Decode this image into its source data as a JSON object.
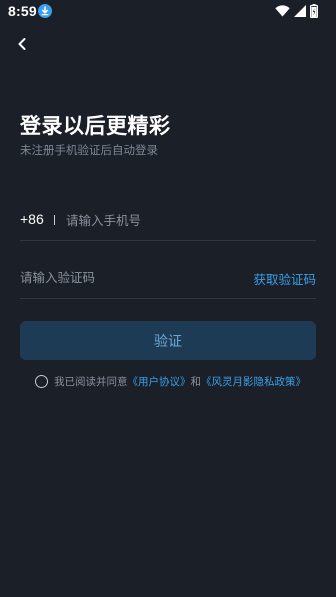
{
  "status_bar": {
    "time": "8:59",
    "download_icon": "download-badge-icon",
    "wifi_icon": "wifi-icon",
    "signal_icon": "cell-signal-icon",
    "battery_icon": "battery-charging-icon"
  },
  "header": {
    "back_icon": "chevron-left-icon"
  },
  "main": {
    "title": "登录以后更精彩",
    "subtitle": "未注册手机验证后自动登录"
  },
  "phone_field": {
    "country_code": "+86",
    "value": "",
    "placeholder": "请输入手机号"
  },
  "code_field": {
    "value": "",
    "placeholder": "请输入验证码",
    "get_code_label": "获取验证码"
  },
  "verify_button": {
    "label": "验证"
  },
  "agreement": {
    "checked": false,
    "prefix": "我已阅读并同意",
    "user_agreement": "《用户协议》",
    "and": "和",
    "privacy_policy": "《风灵月影隐私政策》"
  },
  "colors": {
    "background": "#1a1f28",
    "accent": "#3aa0ea",
    "button_bg": "#1d3b55",
    "button_text": "#6ea9d6",
    "muted_text": "#8a919d"
  }
}
